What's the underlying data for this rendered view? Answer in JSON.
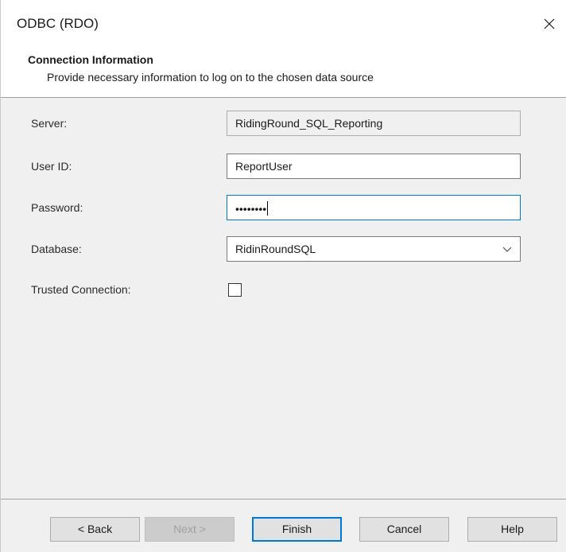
{
  "window": {
    "title": "ODBC (RDO)"
  },
  "header": {
    "title": "Connection Information",
    "subtitle": "Provide necessary information to log on to the chosen data source"
  },
  "form": {
    "server": {
      "label": "Server:",
      "value": "RidingRound_SQL_Reporting"
    },
    "user_id": {
      "label": "User ID:",
      "value": "ReportUser"
    },
    "password": {
      "label": "Password:",
      "masked_value": "••••••••"
    },
    "database": {
      "label": "Database:",
      "value": "RidinRoundSQL"
    },
    "trusted_connection": {
      "label": "Trusted Connection:",
      "checked": false
    }
  },
  "buttons": {
    "back": "< Back",
    "next": "Next >",
    "finish": "Finish",
    "cancel": "Cancel",
    "help": "Help"
  },
  "colors": {
    "focus_border": "#0078d7",
    "dialog_bg": "#f0f0f0"
  }
}
